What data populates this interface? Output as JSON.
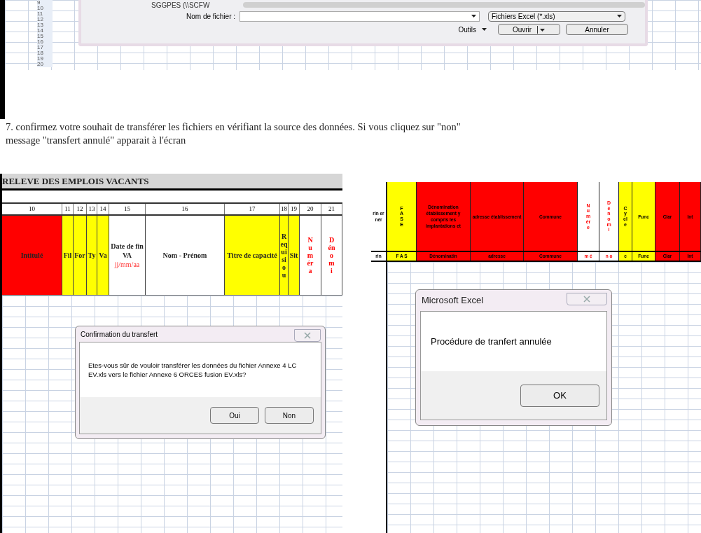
{
  "top_screenshot": {
    "row_numbers": [
      "9",
      "10",
      "11",
      "12",
      "13",
      "14",
      "15",
      "16",
      "17",
      "18",
      "19",
      "20"
    ],
    "file_dialog": {
      "tree_item": "SGGPES (\\\\SCFW",
      "file_name_label": "Nom de fichier :",
      "file_type": "Fichiers Excel (*.xls)",
      "tools_label": "Outils",
      "buttons": [
        {
          "label": "Ouvrir",
          "split": true
        },
        {
          "label": "Annuler",
          "split": false
        }
      ]
    }
  },
  "instruction": {
    "lines": [
      "7. confirmez votre souhait de transférer les fichiers en vérifiant la source des données. Si vous cliquez sur \"non\"",
      "message \"transfert annulé\" apparait à l'écran"
    ]
  },
  "left_screenshot": {
    "title": "RELEVE DES EMPLOIS VACANTS",
    "columns": [
      {
        "number": "10",
        "header": "Intitulé",
        "kind": "horizontal",
        "color": "#ff0000",
        "red_text": false
      },
      {
        "number": "11",
        "header": "Fil",
        "kind": "horizontal",
        "color": "#ffff00",
        "red_text": false
      },
      {
        "number": "12",
        "header": "For",
        "kind": "horizontal",
        "color": "#ffff00",
        "red_text": false
      },
      {
        "number": "13",
        "header": "Ty",
        "kind": "horizontal",
        "color": "#ffff00",
        "red_text": false
      },
      {
        "number": "14",
        "header": "Va",
        "kind": "horizontal",
        "color": "#ffff00",
        "red_text": false
      },
      {
        "number": "15",
        "header": "Date de fin VA",
        "note": "jj/mm/aa",
        "kind": "horizontal",
        "color": "#ffffff",
        "red_text": false
      },
      {
        "number": "16",
        "header": "Nom - Prénom",
        "kind": "horizontal",
        "color": "#ffffff",
        "red_text": false
      },
      {
        "number": "17",
        "header": "Titre de capacité",
        "kind": "horizontal",
        "color": "#ffff00",
        "red_text": false
      },
      {
        "number": "18",
        "header": "Requisiou",
        "kind": "vertical",
        "color": "#ffff00",
        "red_text": false
      },
      {
        "number": "19",
        "header": "Sit",
        "kind": "horizontal",
        "color": "#ffff00",
        "red_text": false
      },
      {
        "number": "20",
        "header": "Numéra",
        "kind": "vertical",
        "color": "#ffffff",
        "red_text": true
      },
      {
        "number": "21",
        "header": "Dénomi",
        "kind": "vertical",
        "color": "#ffffff",
        "red_text": true
      }
    ],
    "dialog": {
      "title": "Confirmation du transfert",
      "message": "Etes-vous sûr de vouloir transférer les données du fichier Annexe 4 LC EV.xls vers le fichier Annexe 6 ORCES fusion EV.xls?",
      "buttons": [
        "Oui",
        "Non"
      ]
    }
  },
  "right_screenshot": {
    "columns": [
      {
        "header": "rin er nér",
        "sub": "rin",
        "kind": "horizontal",
        "color": "#ffffff",
        "red_text": false
      },
      {
        "header": "FASE",
        "sub": "F A S",
        "kind": "vertical",
        "color": "#ffff00",
        "red_text": false
      },
      {
        "header": "Dénomination établissement y compris les implantations et",
        "sub": "Dénominatin",
        "kind": "horizontal",
        "color": "#ff0000",
        "red_text": false
      },
      {
        "header": "adresse établissement",
        "sub": "adresse",
        "kind": "horizontal",
        "color": "#ff0000",
        "red_text": false
      },
      {
        "header": "Commune",
        "sub": "Commune",
        "kind": "horizontal",
        "color": "#ff0000",
        "red_text": false
      },
      {
        "header": "Numére",
        "sub": "m é",
        "kind": "vertical",
        "color": "#ffffff",
        "red_text": true
      },
      {
        "header": "Dénomi",
        "sub": "n o",
        "kind": "vertical",
        "color": "#ffffff",
        "red_text": true
      },
      {
        "header": "Cycle",
        "sub": "c",
        "kind": "vertical",
        "color": "#ffff00",
        "red_text": false
      },
      {
        "header": "Func",
        "sub": "Func",
        "kind": "horizontal",
        "color": "#ffff00",
        "red_text": false
      },
      {
        "header": "Clar",
        "sub": "Clar",
        "kind": "horizontal",
        "color": "#ff0000",
        "red_text": false
      },
      {
        "header": "Int",
        "sub": "Int",
        "kind": "horizontal",
        "color": "#ff0000",
        "red_text": false
      }
    ],
    "dialog": {
      "title": "Microsoft Excel",
      "message": "Procédure de tranfert annulée",
      "buttons": [
        "OK"
      ]
    }
  }
}
